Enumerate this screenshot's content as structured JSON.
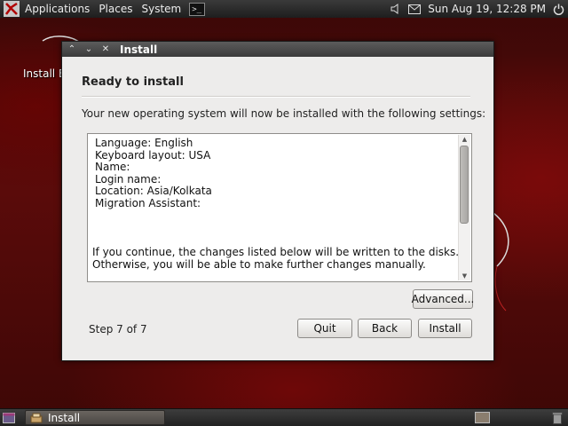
{
  "top_panel": {
    "menus": [
      "Applications",
      "Places",
      "System"
    ],
    "clock": "Sun Aug 19, 12:28 PM",
    "icons": [
      "dragon-logo-icon",
      "terminal-icon",
      "volume-icon",
      "mail-icon",
      "power-icon"
    ]
  },
  "desktop": {
    "icon_label": "Install E"
  },
  "window": {
    "title": "Install",
    "heading": "Ready to install",
    "intro": "Your new operating system will now be installed with the following settings:",
    "summary": {
      "lines": [
        "Language: English",
        "Keyboard layout: USA",
        "Name:",
        "Login name:",
        "Location: Asia/Kolkata",
        "Migration Assistant:"
      ],
      "note_lines": [
        "If you continue, the changes listed below will be written to the disks.",
        "Otherwise, you will be able to make further changes manually."
      ]
    },
    "advanced_label": "Advanced...",
    "step": "Step 7 of 7",
    "buttons": {
      "quit": "Quit",
      "back": "Back",
      "install": "Install"
    }
  },
  "bottom_panel": {
    "task_label": "Install"
  },
  "colors": {
    "desktop": "#5a0b0a",
    "panel": "#2b2b2b",
    "window_bg": "#edeceb",
    "titlebar": "#4a4a4a"
  }
}
